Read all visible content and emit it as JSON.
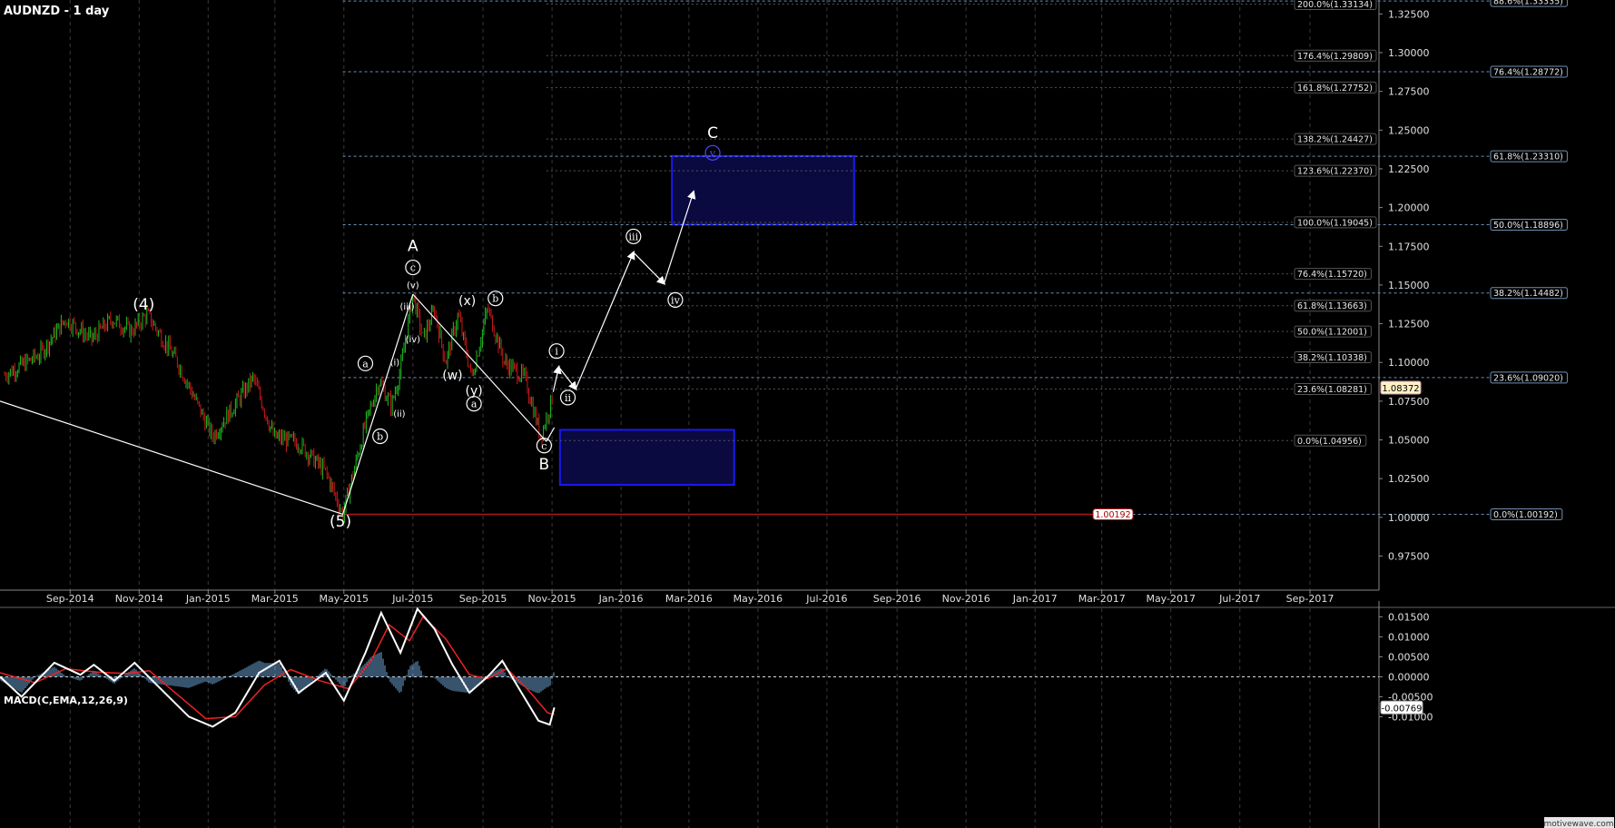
{
  "title": "AUDNZD - 1 day",
  "watermark": "motivewave.com",
  "colors": {
    "bg": "#000000",
    "grid": "#3a3a3a",
    "fib": "#6f8fb3",
    "box_fill": "#0a0a40",
    "box_stroke": "#1a1aee",
    "bull": "#1fbf1f",
    "bear": "#cc1a1a",
    "macd_line": "#ffffff",
    "signal": "#ee2222",
    "hist": "#6fa6d8",
    "white": "#ffffff",
    "support": "#b01818",
    "current_bg": "#fff2c6"
  },
  "chart_data": [
    {
      "type": "candlestick",
      "title": "AUDNZD - 1 day",
      "x_tick_labels": [
        "Sep-2014",
        "Nov-2014",
        "Jan-2015",
        "Mar-2015",
        "May-2015",
        "Jul-2015",
        "Sep-2015",
        "Nov-2015",
        "Jan-2016",
        "Mar-2016",
        "May-2016",
        "Jul-2016",
        "Sep-2016",
        "Nov-2016",
        "Jan-2017",
        "Mar-2017",
        "May-2017",
        "Jul-2017",
        "Sep-2017"
      ],
      "x_range": [
        "2014-07",
        "2017-11"
      ],
      "y_tick_labels": [
        "1.32500",
        "1.30000",
        "1.27500",
        "1.25000",
        "1.22500",
        "1.20000",
        "1.17500",
        "1.15000",
        "1.12500",
        "1.10000",
        "1.07500",
        "1.05000",
        "1.02500",
        "1.00000",
        "0.97500"
      ],
      "y_range": [
        0.953,
        1.334
      ],
      "price_path": [
        [
          "2014-07-05",
          1.092
        ],
        [
          "2014-08-05",
          1.105
        ],
        [
          "2014-08-28",
          1.128
        ],
        [
          "2014-09-20",
          1.115
        ],
        [
          "2014-10-08",
          1.128
        ],
        [
          "2014-10-25",
          1.12
        ],
        [
          "2014-11-08",
          1.131
        ],
        [
          "2014-12-05",
          1.1
        ],
        [
          "2015-01-05",
          1.052
        ],
        [
          "2015-02-10",
          1.09
        ],
        [
          "2015-02-28",
          1.052
        ],
        [
          "2015-03-22",
          1.048
        ],
        [
          "2015-04-15",
          1.029
        ],
        [
          "2015-04-30",
          1.002
        ],
        [
          "2015-05-20",
          1.06
        ],
        [
          "2015-06-01",
          1.088
        ],
        [
          "2015-06-12",
          1.072
        ],
        [
          "2015-06-20",
          1.095
        ],
        [
          "2015-07-01",
          1.144
        ],
        [
          "2015-07-10",
          1.115
        ],
        [
          "2015-07-20",
          1.134
        ],
        [
          "2015-07-30",
          1.1
        ],
        [
          "2015-08-10",
          1.131
        ],
        [
          "2015-08-22",
          1.09
        ],
        [
          "2015-09-05",
          1.135
        ],
        [
          "2015-09-20",
          1.1
        ],
        [
          "2015-10-08",
          1.09
        ],
        [
          "2015-10-22",
          1.052
        ],
        [
          "2015-11-02",
          1.079
        ]
      ],
      "current_price": "1.08372",
      "support_level": "1.00192",
      "fib_left": [
        {
          "label": "88.6%(1.33335)",
          "value": 1.33335
        },
        {
          "label": "76.4%(1.28772)",
          "value": 1.28772
        },
        {
          "label": "61.8%(1.23310)",
          "value": 1.2331
        },
        {
          "label": "50.0%(1.18896)",
          "value": 1.18896
        },
        {
          "label": "38.2%(1.14482)",
          "value": 1.14482
        },
        {
          "label": "23.6%(1.09020)",
          "value": 1.0902
        },
        {
          "label": "0.0%(1.00192)",
          "value": 1.00192
        }
      ],
      "fib_right": [
        {
          "label": "200.0%(1.33134)",
          "value": 1.33134
        },
        {
          "label": "176.4%(1.29809)",
          "value": 1.29809
        },
        {
          "label": "161.8%(1.27752)",
          "value": 1.27752
        },
        {
          "label": "138.2%(1.24427)",
          "value": 1.24427
        },
        {
          "label": "123.6%(1.22370)",
          "value": 1.2237
        },
        {
          "label": "100.0%(1.19045)",
          "value": 1.19045
        },
        {
          "label": "76.4%(1.15720)",
          "value": 1.1572
        },
        {
          "label": "61.8%(1.13663)",
          "value": 1.13663
        },
        {
          "label": "50.0%(1.12001)",
          "value": 1.12001
        },
        {
          "label": "38.2%(1.10338)",
          "value": 1.10338
        },
        {
          "label": "23.6%(1.08281)",
          "value": 1.08281
        },
        {
          "label": "0.0%(1.04956)",
          "value": 1.04956
        }
      ],
      "target_boxes": [
        {
          "from": "2016-02-15",
          "to": "2016-07-25",
          "high": 1.2333,
          "low": 1.189
        },
        {
          "from": "2015-11-08",
          "to": "2016-04-10",
          "high": 1.0565,
          "low": 1.021
        }
      ],
      "wave_lines": [
        [
          [
            "2014-07-01",
            1.075
          ],
          [
            "2015-04-30",
            1.002
          ]
        ],
        [
          [
            "2015-04-30",
            1.002
          ],
          [
            "2015-07-01",
            1.144
          ]
        ],
        [
          [
            "2015-07-01",
            1.144
          ],
          [
            "2015-10-27",
            1.049
          ]
        ],
        [
          [
            "2015-10-27",
            1.049
          ],
          [
            "2015-11-03",
            1.058
          ]
        ]
      ],
      "projection_arrows": [
        [
          [
            "2015-11-02",
            1.081
          ],
          [
            "2015-11-07",
            1.097
          ]
        ],
        [
          [
            "2015-11-07",
            1.097
          ],
          [
            "2015-11-22",
            1.083
          ]
        ],
        [
          [
            "2015-11-22",
            1.083
          ],
          [
            "2016-01-12",
            1.171
          ]
        ],
        [
          [
            "2016-01-12",
            1.171
          ],
          [
            "2016-02-08",
            1.151
          ]
        ],
        [
          [
            "2016-02-08",
            1.151
          ],
          [
            "2016-03-05",
            1.21
          ]
        ]
      ],
      "wave_labels": [
        {
          "text": "(4)",
          "date": "2014-11-05",
          "value": 1.134,
          "circled": false,
          "size": "big"
        },
        {
          "text": "(5)",
          "date": "2015-04-28",
          "value": 0.994,
          "circled": false,
          "size": "big"
        },
        {
          "text": "A",
          "date": "2015-07-01",
          "value": 1.172,
          "circled": false,
          "size": "big"
        },
        {
          "text": "c",
          "date": "2015-07-01",
          "value": 1.159,
          "circled": true,
          "size": "small"
        },
        {
          "text": "(v)",
          "date": "2015-07-01",
          "value": 1.148,
          "circled": false,
          "size": "tiny"
        },
        {
          "text": "(iii)",
          "date": "2015-06-26",
          "value": 1.134,
          "circled": false,
          "size": "tiny"
        },
        {
          "text": "(iv)",
          "date": "2015-07-01",
          "value": 1.113,
          "circled": false,
          "size": "tiny"
        },
        {
          "text": "(i)",
          "date": "2015-06-15",
          "value": 1.098,
          "circled": false,
          "size": "tiny"
        },
        {
          "text": "(ii)",
          "date": "2015-06-19",
          "value": 1.065,
          "circled": false,
          "size": "tiny"
        },
        {
          "text": "a",
          "date": "2015-05-20",
          "value": 1.097,
          "circled": true,
          "size": "small"
        },
        {
          "text": "b",
          "date": "2015-06-02",
          "value": 1.05,
          "circled": true,
          "size": "small"
        },
        {
          "text": "(x)",
          "date": "2015-08-18",
          "value": 1.137,
          "circled": false,
          "size": "mid"
        },
        {
          "text": "(w)",
          "date": "2015-08-05",
          "value": 1.089,
          "circled": false,
          "size": "mid"
        },
        {
          "text": "(y)",
          "date": "2015-08-24",
          "value": 1.079,
          "circled": false,
          "size": "mid"
        },
        {
          "text": "a",
          "date": "2015-08-24",
          "value": 1.071,
          "circled": true,
          "size": "small"
        },
        {
          "text": "b",
          "date": "2015-09-12",
          "value": 1.139,
          "circled": true,
          "size": "small"
        },
        {
          "text": "c",
          "date": "2015-10-25",
          "value": 1.044,
          "circled": true,
          "size": "small"
        },
        {
          "text": "B",
          "date": "2015-10-25",
          "value": 1.031,
          "circled": false,
          "size": "big"
        },
        {
          "text": "i",
          "date": "2015-11-05",
          "value": 1.105,
          "circled": true,
          "size": "small"
        },
        {
          "text": "ii",
          "date": "2015-11-15",
          "value": 1.075,
          "circled": true,
          "size": "small"
        },
        {
          "text": "iii",
          "date": "2016-01-12",
          "value": 1.179,
          "circled": true,
          "size": "small"
        },
        {
          "text": "iv",
          "date": "2016-02-18",
          "value": 1.138,
          "circled": true,
          "size": "small"
        },
        {
          "text": "C",
          "date": "2016-03-22",
          "value": 1.245,
          "circled": false,
          "size": "big"
        },
        {
          "text": "v",
          "date": "2016-03-22",
          "value": 1.233,
          "circled": true,
          "size": "small",
          "color": "#4a4aff"
        }
      ]
    },
    {
      "type": "line",
      "title": "MACD(C,EMA,12,26,9)",
      "series": [
        {
          "name": "MACD"
        },
        {
          "name": "Signal"
        },
        {
          "name": "Histogram"
        }
      ],
      "y_tick_labels": [
        "0.01500",
        "0.01000",
        "0.00500",
        "0.00000",
        "-0.00500",
        "-0.01000"
      ],
      "y_range": [
        -0.0124,
        0.0176
      ],
      "current_value": "-0.00769",
      "macd_path": [
        [
          "2014-07-01",
          0.0
        ],
        [
          "2014-07-20",
          -0.005
        ],
        [
          "2014-08-18",
          0.0035
        ],
        [
          "2014-09-10",
          0.0005
        ],
        [
          "2014-09-22",
          0.003
        ],
        [
          "2014-10-10",
          -0.001
        ],
        [
          "2014-10-28",
          0.0035
        ],
        [
          "2014-11-20",
          -0.003
        ],
        [
          "2014-12-15",
          -0.01
        ],
        [
          "2015-01-05",
          -0.0125
        ],
        [
          "2015-01-25",
          -0.009
        ],
        [
          "2015-02-15",
          0.001
        ],
        [
          "2015-03-05",
          0.004
        ],
        [
          "2015-03-22",
          -0.004
        ],
        [
          "2015-04-15",
          0.001
        ],
        [
          "2015-05-01",
          -0.006
        ],
        [
          "2015-05-20",
          0.006
        ],
        [
          "2015-06-03",
          0.016
        ],
        [
          "2015-06-20",
          0.006
        ],
        [
          "2015-07-05",
          0.017
        ],
        [
          "2015-07-20",
          0.012
        ],
        [
          "2015-08-05",
          0.003
        ],
        [
          "2015-08-20",
          -0.004
        ],
        [
          "2015-09-05",
          0.0
        ],
        [
          "2015-09-18",
          0.004
        ],
        [
          "2015-10-05",
          -0.004
        ],
        [
          "2015-10-20",
          -0.011
        ],
        [
          "2015-10-30",
          -0.012
        ],
        [
          "2015-11-03",
          -0.0077
        ]
      ],
      "signal_path": [
        [
          "2014-07-01",
          0.001
        ],
        [
          "2014-08-01",
          -0.0015
        ],
        [
          "2014-08-28",
          0.002
        ],
        [
          "2014-09-25",
          0.0012
        ],
        [
          "2014-10-20",
          0.0008
        ],
        [
          "2014-11-10",
          0.0015
        ],
        [
          "2014-12-05",
          -0.0045
        ],
        [
          "2014-12-30",
          -0.0105
        ],
        [
          "2015-01-25",
          -0.01
        ],
        [
          "2015-02-20",
          -0.002
        ],
        [
          "2015-03-15",
          0.0018
        ],
        [
          "2015-04-10",
          -0.001
        ],
        [
          "2015-05-05",
          -0.003
        ],
        [
          "2015-05-25",
          0.004
        ],
        [
          "2015-06-10",
          0.013
        ],
        [
          "2015-06-28",
          0.009
        ],
        [
          "2015-07-10",
          0.015
        ],
        [
          "2015-07-30",
          0.0095
        ],
        [
          "2015-08-20",
          0.0005
        ],
        [
          "2015-09-05",
          -0.0005
        ],
        [
          "2015-09-22",
          0.002
        ],
        [
          "2015-10-10",
          -0.003
        ],
        [
          "2015-10-28",
          -0.009
        ],
        [
          "2015-11-03",
          -0.0095
        ]
      ],
      "hist_range": [
        "2014-07-01",
        "2015-11-03"
      ]
    }
  ]
}
